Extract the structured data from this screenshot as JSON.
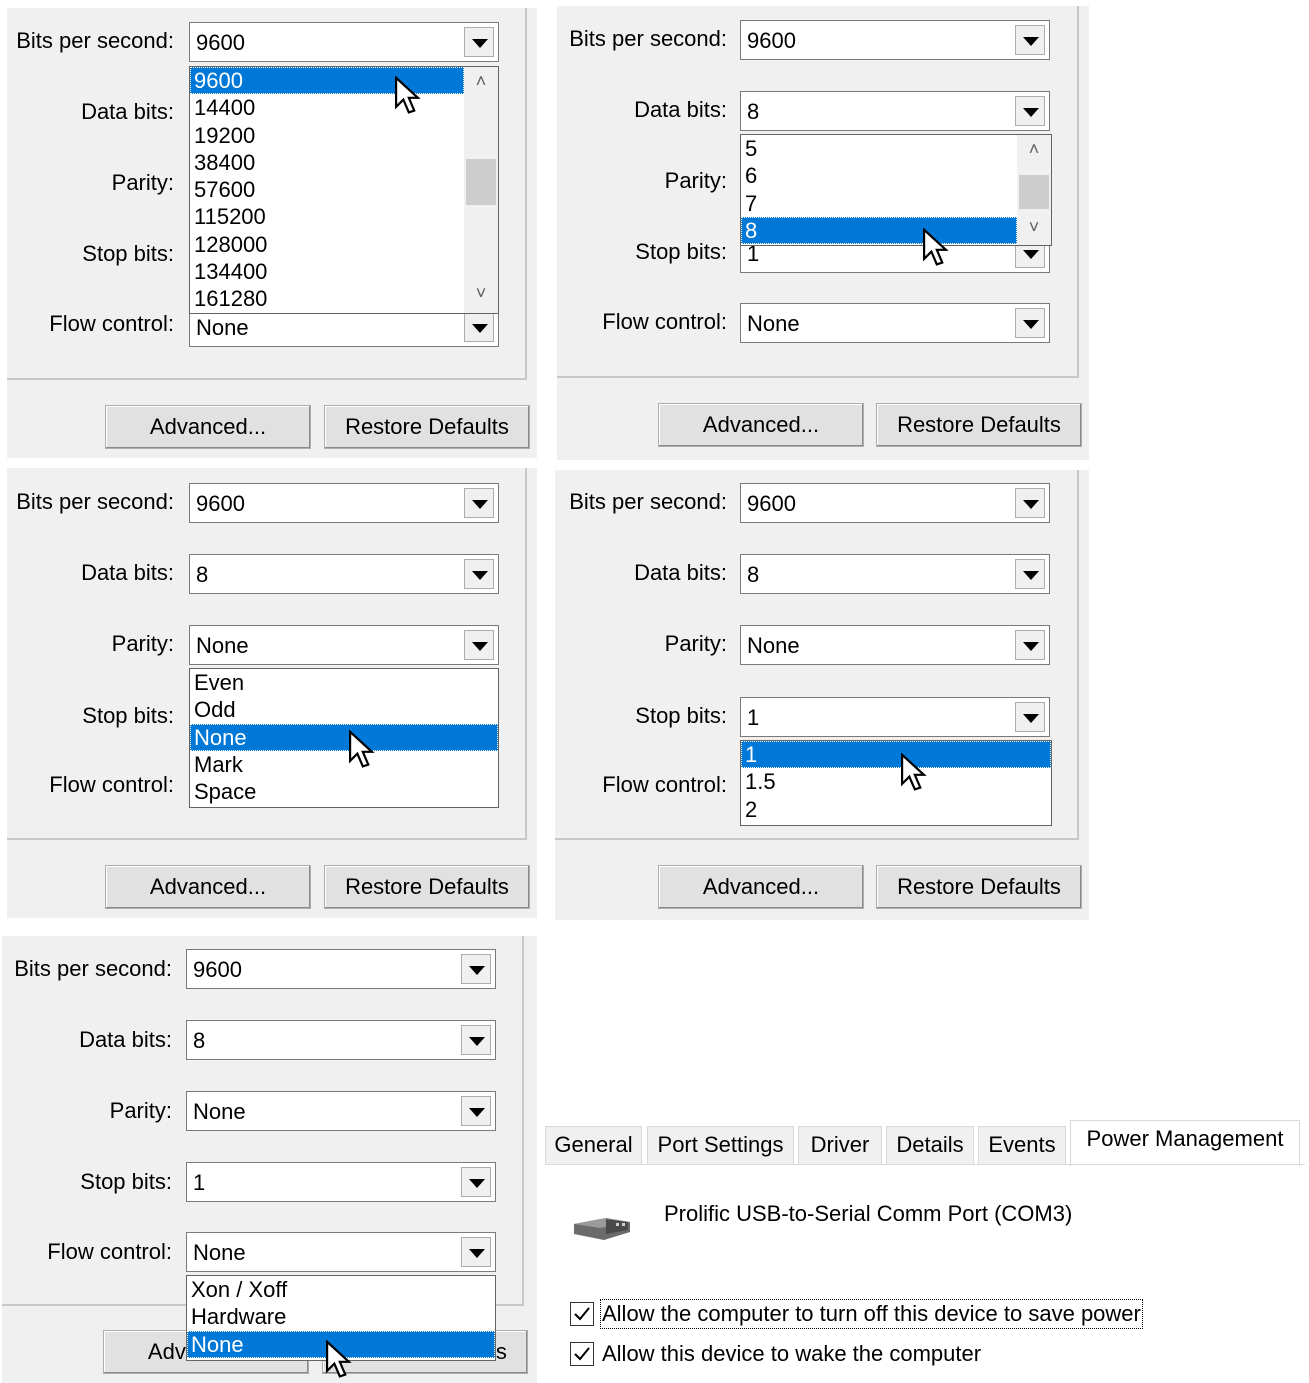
{
  "labels": {
    "bits_per_second": "Bits per second:",
    "data_bits": "Data bits:",
    "parity": "Parity:",
    "stop_bits": "Stop bits:",
    "flow_control": "Flow control:"
  },
  "buttons": {
    "advanced": "Advanced...",
    "restore_defaults": "Restore Defaults"
  },
  "panel1": {
    "bits_value": "9600",
    "flow_value": "None",
    "dropdown_options": [
      "9600",
      "14400",
      "19200",
      "38400",
      "57600",
      "115200",
      "128000",
      "134400",
      "161280"
    ],
    "selected": "9600"
  },
  "panel2": {
    "bits_value": "9600",
    "data_value": "8",
    "stop_value": "1",
    "flow_value": "None",
    "dropdown_options": [
      "5",
      "6",
      "7",
      "8"
    ],
    "selected": "8"
  },
  "panel3": {
    "bits_value": "9600",
    "data_value": "8",
    "parity_value": "None",
    "dropdown_options": [
      "Even",
      "Odd",
      "None",
      "Mark",
      "Space"
    ],
    "selected": "None"
  },
  "panel4": {
    "bits_value": "9600",
    "data_value": "8",
    "parity_value": "None",
    "stop_value": "1",
    "dropdown_options": [
      "1",
      "1.5",
      "2"
    ],
    "selected": "1"
  },
  "panel5": {
    "bits_value": "9600",
    "data_value": "8",
    "parity_value": "None",
    "stop_value": "1",
    "flow_value": "None",
    "dropdown_options": [
      "Xon / Xoff",
      "Hardware",
      "None"
    ],
    "selected": "None"
  },
  "power": {
    "tabs": [
      "General",
      "Port Settings",
      "Driver",
      "Details",
      "Events",
      "Power Management"
    ],
    "active_tab": "Power Management",
    "device_name": "Prolific USB-to-Serial Comm Port (COM3)",
    "checkbox1": "Allow the computer to turn off this device to save power",
    "checkbox2": "Allow this device to wake the computer",
    "checkbox1_checked": true,
    "checkbox2_checked": true
  },
  "colors": {
    "selection": "#0078d7",
    "panel_bg": "#f0f0f0"
  }
}
